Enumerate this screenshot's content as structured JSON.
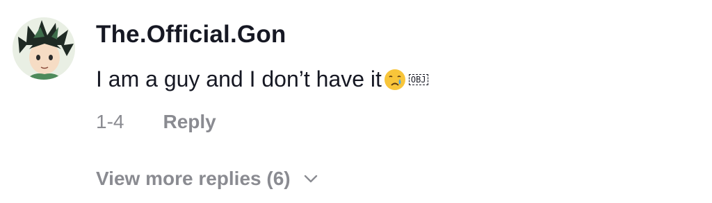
{
  "comment": {
    "username": "The.Official.Gon",
    "text": "I am a guy and I don’t have it",
    "emoji_icon": "crying-face-icon",
    "obj_marker": "OBJ",
    "date": "1-4",
    "reply_label": "Reply"
  },
  "replies": {
    "view_more_label": "View more replies (6)"
  },
  "colors": {
    "primary_text": "#161823",
    "secondary_text": "#8a8b91"
  }
}
